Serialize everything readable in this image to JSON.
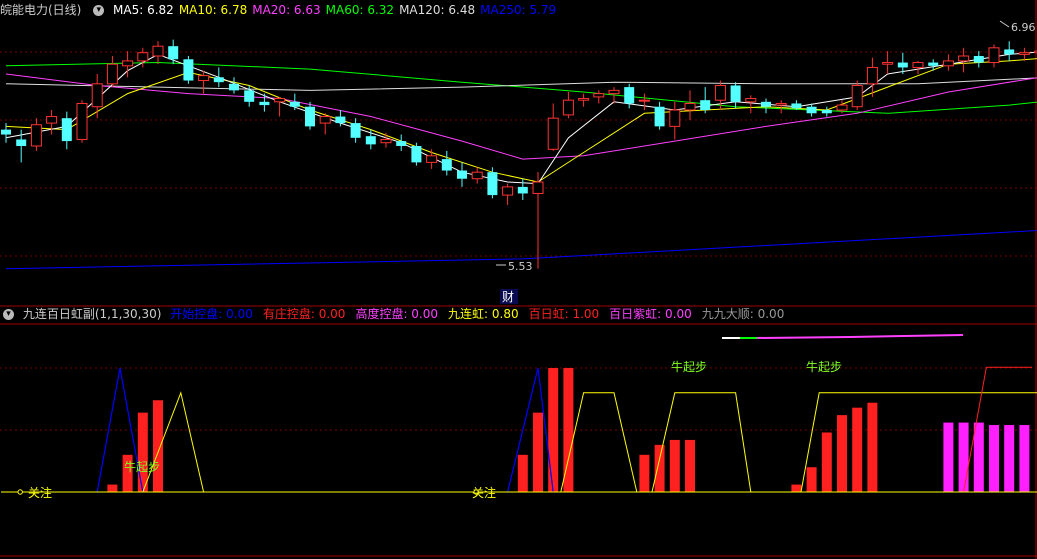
{
  "main_header": {
    "title": "皖能电力(日线)",
    "ma_items": [
      {
        "label": "MA5: 6.82",
        "color": "#ffffff"
      },
      {
        "label": "MA10: 6.78",
        "color": "#ffff00"
      },
      {
        "label": "MA20: 6.63",
        "color": "#ff40ff"
      },
      {
        "label": "MA60: 6.32",
        "color": "#00ff00"
      },
      {
        "label": "MA120: 6.48",
        "color": "#dddddd"
      },
      {
        "label": "MA250: 5.79",
        "color": "#0000ff"
      }
    ]
  },
  "indicator_header": {
    "title": "九连百日虹副(1,1,30,30)",
    "items": [
      {
        "name": "开始控盘",
        "value": "0.00",
        "color": "#0000ff"
      },
      {
        "name": "有庄控盘",
        "value": "0.00",
        "color": "#ff2020"
      },
      {
        "name": "高度控盘",
        "value": "0.00",
        "color": "#ff40ff"
      },
      {
        "name": "九连虹",
        "value": "0.80",
        "color": "#ffff00"
      },
      {
        "name": "百日虹",
        "value": "1.00",
        "color": "#ff2020"
      },
      {
        "name": "百日紫虹",
        "value": "0.00",
        "color": "#ff40ff"
      },
      {
        "name": "九九大顺",
        "value": "0.00",
        "color": "#999999"
      }
    ]
  },
  "labels": {
    "high_mark": "6.96",
    "low_mark": "5.53",
    "cai": "财",
    "niu1": "牛起步",
    "niu2": "牛起步",
    "niu3": "牛起步",
    "guanzhu1": "关注",
    "guanzhu2": "关注"
  },
  "chart_data": {
    "type": "candlestick",
    "title": "皖能电力(日线)",
    "ylim": [
      5.4,
      7.05
    ],
    "candles": [
      [
        6.38,
        6.42,
        6.3,
        6.35
      ],
      [
        6.32,
        6.38,
        6.18,
        6.28
      ],
      [
        6.28,
        6.45,
        6.25,
        6.41
      ],
      [
        6.42,
        6.5,
        6.35,
        6.46
      ],
      [
        6.45,
        6.49,
        6.26,
        6.31
      ],
      [
        6.32,
        6.56,
        6.3,
        6.54
      ],
      [
        6.52,
        6.72,
        6.45,
        6.66
      ],
      [
        6.66,
        6.83,
        6.64,
        6.78
      ],
      [
        6.77,
        6.86,
        6.7,
        6.8
      ],
      [
        6.8,
        6.88,
        6.76,
        6.85
      ],
      [
        6.83,
        6.92,
        6.78,
        6.89
      ],
      [
        6.89,
        6.93,
        6.78,
        6.81
      ],
      [
        6.81,
        6.83,
        6.66,
        6.68
      ],
      [
        6.68,
        6.74,
        6.6,
        6.71
      ],
      [
        6.7,
        6.76,
        6.64,
        6.67
      ],
      [
        6.66,
        6.7,
        6.6,
        6.62
      ],
      [
        6.62,
        6.65,
        6.52,
        6.55
      ],
      [
        6.55,
        6.6,
        6.49,
        6.53
      ],
      [
        6.55,
        6.58,
        6.46,
        6.57
      ],
      [
        6.55,
        6.6,
        6.5,
        6.52
      ],
      [
        6.52,
        6.55,
        6.38,
        6.4
      ],
      [
        6.42,
        6.48,
        6.35,
        6.46
      ],
      [
        6.46,
        6.5,
        6.4,
        6.42
      ],
      [
        6.42,
        6.45,
        6.3,
        6.33
      ],
      [
        6.34,
        6.38,
        6.26,
        6.29
      ],
      [
        6.3,
        6.36,
        6.27,
        6.32
      ],
      [
        6.31,
        6.35,
        6.25,
        6.28
      ],
      [
        6.28,
        6.3,
        6.16,
        6.18
      ],
      [
        6.18,
        6.26,
        6.14,
        6.22
      ],
      [
        6.2,
        6.25,
        6.1,
        6.13
      ],
      [
        6.13,
        6.18,
        6.03,
        6.08
      ],
      [
        6.08,
        6.15,
        6.05,
        6.12
      ],
      [
        6.12,
        6.15,
        5.96,
        5.98
      ],
      [
        5.98,
        6.05,
        5.92,
        6.03
      ],
      [
        6.03,
        6.08,
        5.95,
        5.99
      ],
      [
        5.99,
        6.12,
        5.53,
        6.06
      ],
      [
        6.26,
        6.54,
        6.25,
        6.45
      ],
      [
        6.47,
        6.61,
        6.45,
        6.56
      ],
      [
        6.56,
        6.6,
        6.52,
        6.57
      ],
      [
        6.58,
        6.62,
        6.54,
        6.6
      ],
      [
        6.6,
        6.64,
        6.54,
        6.62
      ],
      [
        6.64,
        6.66,
        6.51,
        6.54
      ],
      [
        6.56,
        6.6,
        6.5,
        6.56
      ],
      [
        6.52,
        6.55,
        6.38,
        6.4
      ],
      [
        6.4,
        6.55,
        6.32,
        6.5
      ],
      [
        6.5,
        6.62,
        6.44,
        6.54
      ],
      [
        6.56,
        6.64,
        6.48,
        6.5
      ],
      [
        6.56,
        6.68,
        6.5,
        6.65
      ],
      [
        6.65,
        6.67,
        6.51,
        6.55
      ],
      [
        6.55,
        6.59,
        6.48,
        6.57
      ],
      [
        6.55,
        6.57,
        6.48,
        6.52
      ],
      [
        6.53,
        6.56,
        6.48,
        6.54
      ],
      [
        6.54,
        6.56,
        6.5,
        6.51
      ],
      [
        6.52,
        6.54,
        6.46,
        6.48
      ],
      [
        6.5,
        6.52,
        6.46,
        6.48
      ],
      [
        6.5,
        6.56,
        6.48,
        6.53
      ],
      [
        6.52,
        6.68,
        6.5,
        6.65
      ],
      [
        6.66,
        6.82,
        6.58,
        6.76
      ],
      [
        6.78,
        6.86,
        6.72,
        6.79
      ],
      [
        6.79,
        6.85,
        6.72,
        6.76
      ],
      [
        6.76,
        6.8,
        6.72,
        6.79
      ],
      [
        6.79,
        6.81,
        6.74,
        6.77
      ],
      [
        6.77,
        6.84,
        6.74,
        6.8
      ],
      [
        6.8,
        6.88,
        6.73,
        6.83
      ],
      [
        6.83,
        6.86,
        6.76,
        6.79
      ],
      [
        6.79,
        6.9,
        6.76,
        6.88
      ],
      [
        6.87,
        6.92,
        6.8,
        6.84
      ],
      [
        6.84,
        6.88,
        6.8,
        6.85
      ],
      [
        6.85,
        6.9,
        6.81,
        6.86
      ],
      [
        6.86,
        6.92,
        6.82,
        6.9
      ],
      [
        6.89,
        6.96,
        6.82,
        6.92
      ],
      [
        6.88,
        6.94,
        6.84,
        6.87
      ]
    ],
    "ma_lines": [
      {
        "name": "MA250",
        "color": "#0000ff",
        "values": [
          [
            0,
            5.53
          ],
          [
            34,
            5.59
          ],
          [
            73,
            5.79
          ]
        ]
      },
      {
        "name": "MA60",
        "color": "#00ff00",
        "values": [
          [
            0,
            6.77
          ],
          [
            10,
            6.79
          ],
          [
            20,
            6.75
          ],
          [
            30,
            6.67
          ],
          [
            38,
            6.61
          ],
          [
            48,
            6.52
          ],
          [
            58,
            6.48
          ],
          [
            66,
            6.53
          ],
          [
            73,
            6.6
          ]
        ]
      },
      {
        "name": "MA120",
        "color": "#dddddd",
        "values": [
          [
            0,
            6.66
          ],
          [
            10,
            6.64
          ],
          [
            20,
            6.62
          ],
          [
            30,
            6.64
          ],
          [
            40,
            6.67
          ],
          [
            50,
            6.66
          ],
          [
            60,
            6.66
          ],
          [
            73,
            6.72
          ]
        ]
      },
      {
        "name": "MA20",
        "color": "#ff40ff",
        "values": [
          [
            0,
            6.72
          ],
          [
            6,
            6.65
          ],
          [
            12,
            6.6
          ],
          [
            18,
            6.57
          ],
          [
            24,
            6.46
          ],
          [
            30,
            6.31
          ],
          [
            34,
            6.2
          ],
          [
            38,
            6.22
          ],
          [
            44,
            6.31
          ],
          [
            50,
            6.4
          ],
          [
            56,
            6.48
          ],
          [
            62,
            6.61
          ],
          [
            68,
            6.7
          ],
          [
            73,
            6.79
          ]
        ]
      },
      {
        "name": "MA10",
        "color": "#ffff00",
        "values": [
          [
            0,
            6.4
          ],
          [
            4,
            6.38
          ],
          [
            8,
            6.6
          ],
          [
            12,
            6.73
          ],
          [
            16,
            6.65
          ],
          [
            20,
            6.5
          ],
          [
            24,
            6.38
          ],
          [
            28,
            6.24
          ],
          [
            32,
            6.12
          ],
          [
            35,
            6.06
          ],
          [
            38,
            6.24
          ],
          [
            42,
            6.48
          ],
          [
            46,
            6.5
          ],
          [
            50,
            6.52
          ],
          [
            54,
            6.5
          ],
          [
            58,
            6.64
          ],
          [
            62,
            6.78
          ],
          [
            66,
            6.8
          ],
          [
            70,
            6.83
          ],
          [
            73,
            6.86
          ]
        ]
      },
      {
        "name": "MA5",
        "color": "#ffffff",
        "values": [
          [
            0,
            6.33
          ],
          [
            4,
            6.4
          ],
          [
            8,
            6.74
          ],
          [
            10,
            6.84
          ],
          [
            14,
            6.7
          ],
          [
            18,
            6.55
          ],
          [
            22,
            6.42
          ],
          [
            26,
            6.3
          ],
          [
            30,
            6.12
          ],
          [
            33,
            6.06
          ],
          [
            35,
            6.05
          ],
          [
            37,
            6.33
          ],
          [
            40,
            6.55
          ],
          [
            44,
            6.5
          ],
          [
            48,
            6.55
          ],
          [
            52,
            6.52
          ],
          [
            56,
            6.58
          ],
          [
            58,
            6.72
          ],
          [
            62,
            6.78
          ],
          [
            66,
            6.84
          ],
          [
            70,
            6.87
          ],
          [
            73,
            6.89
          ]
        ]
      }
    ],
    "indicator": {
      "bars": [
        {
          "start": 7,
          "end": 10,
          "color": "#ff2020",
          "values": [
            0.06,
            0.3,
            0.64,
            0.74
          ]
        },
        {
          "start": 34,
          "end": 37,
          "color": "#ff2020",
          "values": [
            0.3,
            0.64,
            1.0,
            1.0
          ]
        },
        {
          "start": 42,
          "end": 45,
          "color": "#ff2020",
          "values": [
            0.3,
            0.38,
            0.42,
            0.42
          ]
        },
        {
          "start": 52,
          "end": 57,
          "color": "#ff2020",
          "values": [
            0.06,
            0.2,
            0.48,
            0.62,
            0.68,
            0.72
          ]
        },
        {
          "start": 62,
          "end": 67,
          "color": "#ff20ff",
          "values": [
            0.56,
            0.56,
            0.56,
            0.54,
            0.54,
            0.54
          ]
        }
      ],
      "blue_spikes": [
        [
          6,
          7.5,
          9
        ],
        [
          33,
          35,
          36
        ]
      ],
      "yellow_path": [
        [
          9,
          0
        ],
        [
          11.5,
          1.0
        ],
        [
          13,
          0
        ],
        [
          36.5,
          0
        ],
        [
          38,
          1.0
        ],
        [
          40,
          1.0
        ],
        [
          41.5,
          0
        ],
        [
          42.5,
          0
        ],
        [
          44,
          1.0
        ],
        [
          48,
          1.0
        ],
        [
          49,
          0
        ],
        [
          52.3,
          0
        ],
        [
          53.5,
          1.0
        ],
        [
          73,
          1.0
        ]
      ],
      "red_line": [
        [
          63,
          0
        ],
        [
          64.5,
          1.6
        ],
        [
          67.5,
          1.6
        ]
      ],
      "guanzhu_markers": [
        1,
        31
      ],
      "guanzhu_color": "#ffff00",
      "niu_color": "#80ff20"
    }
  }
}
